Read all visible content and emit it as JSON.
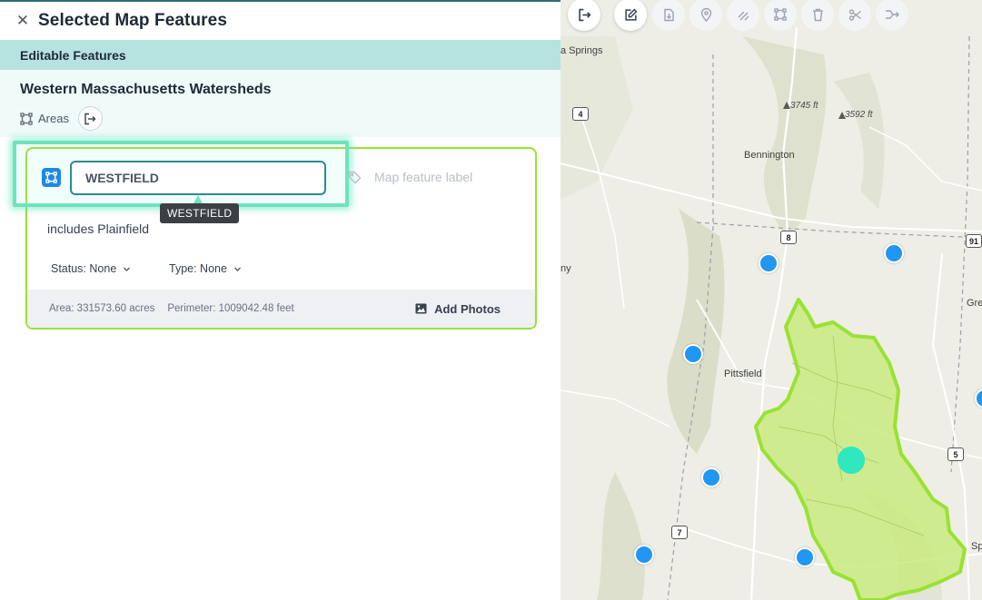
{
  "panel": {
    "title": "Selected Map Features",
    "close_icon": "close-icon",
    "section_header": "Editable Features",
    "layer_name": "Western Massachusetts Watersheds",
    "layer_type": "Areas",
    "feature": {
      "name_value": "WESTFIELD",
      "tooltip": "WESTFIELD",
      "label_placeholder": "Map feature label",
      "description": "includes Plainfield",
      "status_label": "Status: None",
      "type_label": "Type: None",
      "area": "Area: 331573.60 acres",
      "perimeter": "Perimeter: 1009042.48 feet",
      "add_photos": "Add Photos"
    }
  },
  "map": {
    "toolbar_icons": [
      "exit-icon",
      "edit-icon",
      "import-icon",
      "pin-icon",
      "freehand-icon",
      "polygon-icon",
      "trash-icon",
      "scissors-icon",
      "split-icon"
    ],
    "place_labels": {
      "springs": "a Springs",
      "bennington": "Bennington",
      "pittsfield": "Pittsfield",
      "greenfield_partial": "Gre",
      "sp_partial": "Sp",
      "ny_partial": "ny"
    },
    "elevations": [
      "3745 ft",
      "3592 ft"
    ],
    "shields": [
      "4",
      "8",
      "91",
      "5",
      "7"
    ],
    "colors": {
      "polygon_fill": "#c9ea7f",
      "polygon_stroke": "#99e233",
      "marker": "#2196f3",
      "selected_marker": "#2ee8bf"
    }
  }
}
